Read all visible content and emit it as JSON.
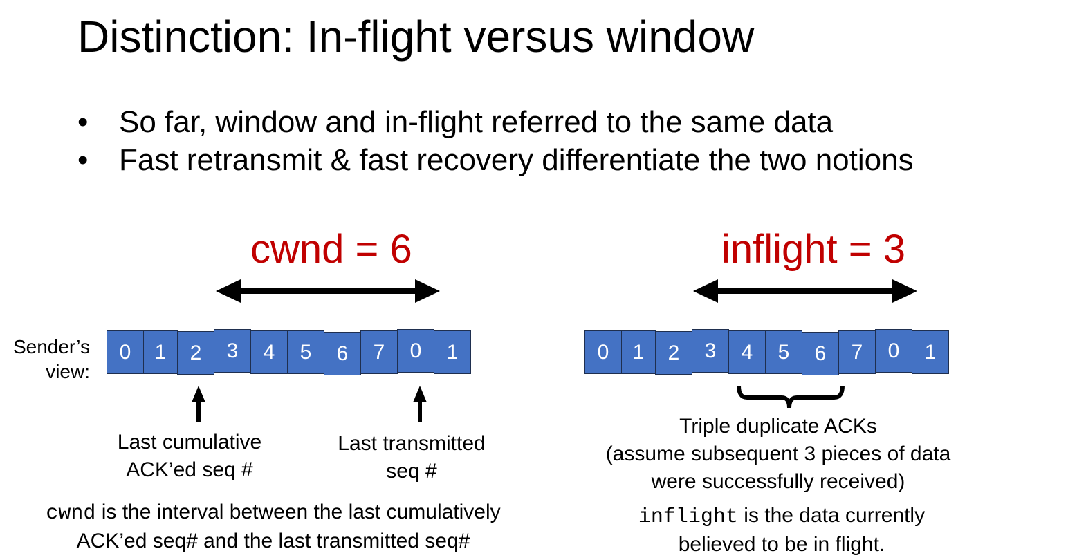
{
  "slide": {
    "title": "Distinction: In-flight versus window",
    "bullets": [
      {
        "marker": "•",
        "text": "So far, window and in-flight referred to the same data"
      },
      {
        "marker": "•",
        "text": "Fast retransmit & fast recovery differentiate the two notions"
      }
    ]
  },
  "left": {
    "label": "cwnd = 6",
    "sender_view": "Sender’s view:",
    "seq_numbers": [
      "0",
      "1",
      "2",
      "3",
      "4",
      "5",
      "6",
      "7",
      "0",
      "1"
    ],
    "arrow1_caption": [
      "Last cumulative",
      "ACK’ed seq #"
    ],
    "arrow2_caption": [
      "Last transmitted",
      "seq #"
    ],
    "note_code": "cwnd",
    "note_line1": " is the interval between the last cumulatively",
    "note_line2": "ACK’ed seq# and the last transmitted seq#"
  },
  "right": {
    "label": "inflight = 3",
    "seq_numbers": [
      "0",
      "1",
      "2",
      "3",
      "4",
      "5",
      "6",
      "7",
      "0",
      "1"
    ],
    "brace_caption": [
      "Triple duplicate ACKs",
      "(assume subsequent 3 pieces of data",
      "were successfully received)"
    ],
    "note_code": "inflight",
    "note_line1": " is the data currently",
    "note_line2": "believed to be in flight."
  },
  "colors": {
    "cell_fill": "#4472c4",
    "accent_red": "#c00000"
  }
}
